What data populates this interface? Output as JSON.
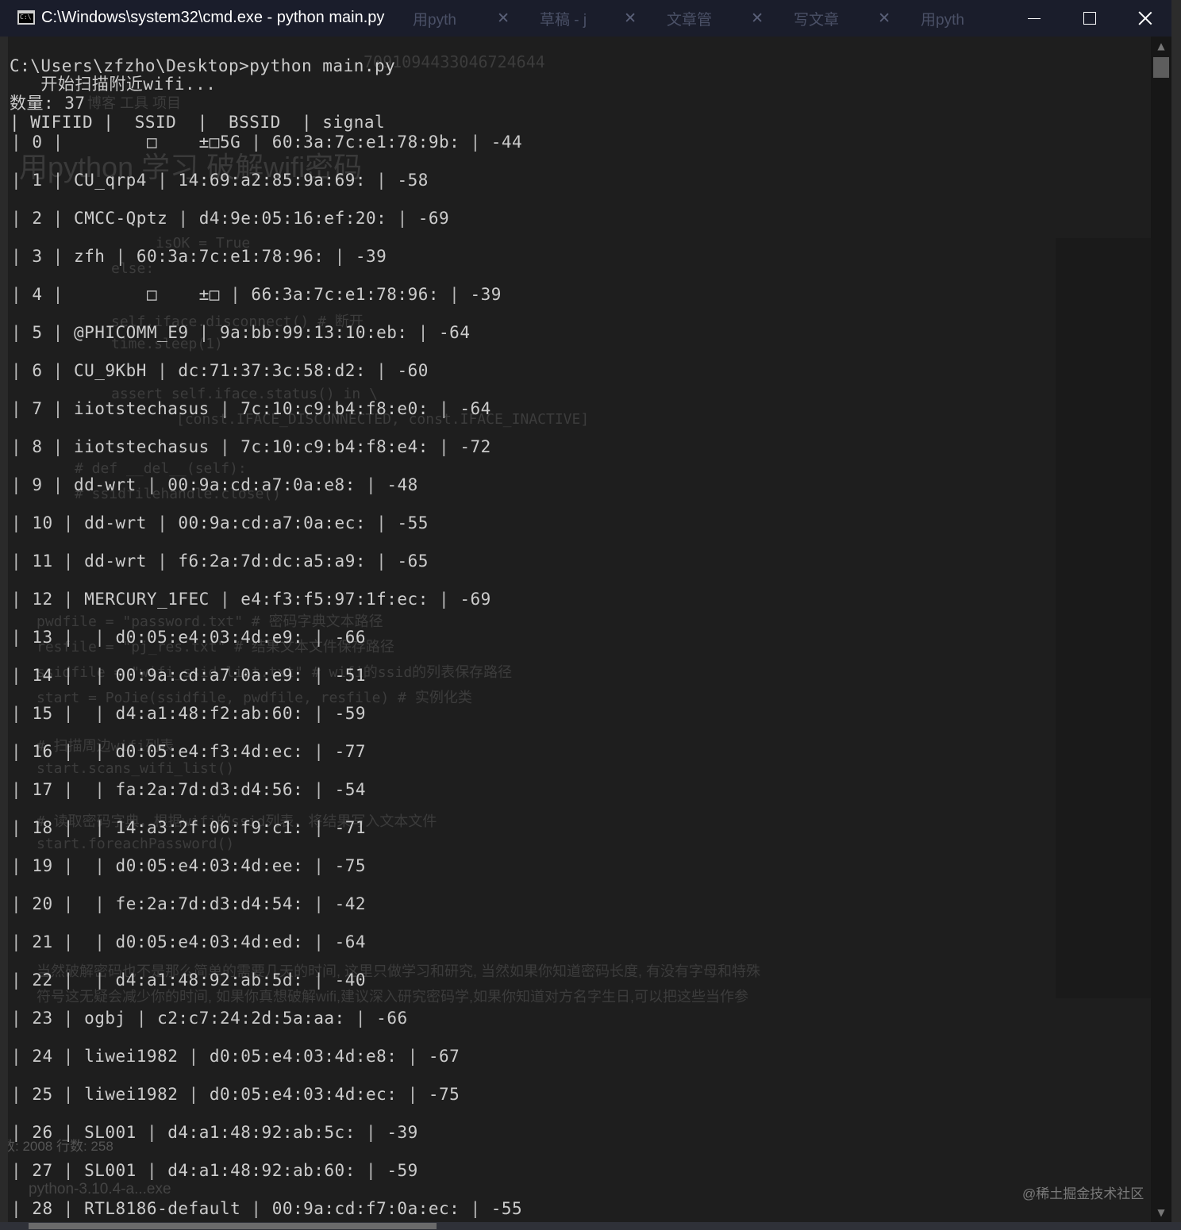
{
  "window": {
    "title": "C:\\Windows\\system32\\cmd.exe - python  main.py",
    "background_tabs": [
      "用pyth",
      "草稿 - j",
      "文章管",
      "写文章",
      "用pyth"
    ]
  },
  "console": {
    "command_line": "C:\\Users\\zfzho\\Desktop>python main.py",
    "scan_message": "   开始扫描附近wifi...",
    "count_line": "数量: 37",
    "header_line": "| WIFIID |  SSID  |  BSSID  | signal",
    "rows": [
      {
        "id": "0",
        "ssid": "       □    ±□5G",
        "bssid": "60:3a:7c:e1:78:9b:",
        "signal": "-44"
      },
      {
        "id": "1",
        "ssid": "CU_qrp4",
        "bssid": "14:69:a2:85:9a:69:",
        "signal": "-58"
      },
      {
        "id": "2",
        "ssid": "CMCC-Qptz",
        "bssid": "d4:9e:05:16:ef:20:",
        "signal": "-69"
      },
      {
        "id": "3",
        "ssid": "zfh",
        "bssid": "60:3a:7c:e1:78:96:",
        "signal": "-39"
      },
      {
        "id": "4",
        "ssid": "       □    ±□",
        "bssid": "66:3a:7c:e1:78:96:",
        "signal": "-39"
      },
      {
        "id": "5",
        "ssid": "@PHICOMM_E9",
        "bssid": "9a:bb:99:13:10:eb:",
        "signal": "-64"
      },
      {
        "id": "6",
        "ssid": "CU_9KbH",
        "bssid": "dc:71:37:3c:58:d2:",
        "signal": "-60"
      },
      {
        "id": "7",
        "ssid": "iiotstechasus",
        "bssid": "7c:10:c9:b4:f8:e0:",
        "signal": "-64"
      },
      {
        "id": "8",
        "ssid": "iiotstechasus",
        "bssid": "7c:10:c9:b4:f8:e4:",
        "signal": "-72"
      },
      {
        "id": "9",
        "ssid": "dd-wrt",
        "bssid": "00:9a:cd:a7:0a:e8:",
        "signal": "-48"
      },
      {
        "id": "10",
        "ssid": "dd-wrt",
        "bssid": "00:9a:cd:a7:0a:ec:",
        "signal": "-55"
      },
      {
        "id": "11",
        "ssid": "dd-wrt",
        "bssid": "f6:2a:7d:dc:a5:a9:",
        "signal": "-65"
      },
      {
        "id": "12",
        "ssid": "MERCURY_1FEC",
        "bssid": "e4:f3:f5:97:1f:ec:",
        "signal": "-69"
      },
      {
        "id": "13",
        "ssid": "",
        "bssid": "d0:05:e4:03:4d:e9:",
        "signal": "-66"
      },
      {
        "id": "14",
        "ssid": "",
        "bssid": "00:9a:cd:a7:0a:e9:",
        "signal": "-51"
      },
      {
        "id": "15",
        "ssid": "",
        "bssid": "d4:a1:48:f2:ab:60:",
        "signal": "-59"
      },
      {
        "id": "16",
        "ssid": "",
        "bssid": "d0:05:e4:f3:4d:ec:",
        "signal": "-77"
      },
      {
        "id": "17",
        "ssid": "",
        "bssid": "fa:2a:7d:d3:d4:56:",
        "signal": "-54"
      },
      {
        "id": "18",
        "ssid": "",
        "bssid": "14:a3:2f:06:f9:c1:",
        "signal": "-71"
      },
      {
        "id": "19",
        "ssid": "",
        "bssid": "d0:05:e4:03:4d:ee:",
        "signal": "-75"
      },
      {
        "id": "20",
        "ssid": "",
        "bssid": "fe:2a:7d:d3:d4:54:",
        "signal": "-42"
      },
      {
        "id": "21",
        "ssid": "",
        "bssid": "d0:05:e4:03:4d:ed:",
        "signal": "-64"
      },
      {
        "id": "22",
        "ssid": "",
        "bssid": "d4:a1:48:92:ab:5d:",
        "signal": "-40"
      },
      {
        "id": "23",
        "ssid": "ogbj",
        "bssid": "c2:c7:24:2d:5a:aa:",
        "signal": "-66"
      },
      {
        "id": "24",
        "ssid": "liwei1982",
        "bssid": "d0:05:e4:03:4d:e8:",
        "signal": "-67"
      },
      {
        "id": "25",
        "ssid": "liwei1982",
        "bssid": "d0:05:e4:03:4d:ec:",
        "signal": "-75"
      },
      {
        "id": "26",
        "ssid": "SL001",
        "bssid": "d4:a1:48:92:ab:5c:",
        "signal": "-39"
      },
      {
        "id": "27",
        "ssid": "SL001",
        "bssid": "d4:a1:48:92:ab:60:",
        "signal": "-59"
      },
      {
        "id": "28",
        "ssid": "RTL8186-default",
        "bssid": "00:9a:cd:f7:0a:ec:",
        "signal": "-55"
      }
    ]
  },
  "background_ghost": {
    "url_fragment": "7091094433046724644",
    "bookmarks": "博客     工具     项目",
    "article_title": "用python 学习 破解wifi密码",
    "code_lines": [
      "isOK = True",
      "else:",
      "self.iface.disconnect()  # 断开",
      "time.sleep(1)",
      "assert self.iface.status() in \\",
      "[const.IFACE_DISCONNECTED, const.IFACE_INACTIVE]",
      "# def __del__(self):",
      "#     ssidfilehandle.close()",
      "pwdfile   = \"password.txt\"  # 密码字典文本路径",
      "resfile   = \"pj_res.txt\"  # 结果文本文件保存路径",
      "ssidfile = \"wifi_ssid_list.txt\"  # wifi的ssid的列表保存路径",
      "start      = PoJie(ssidfile, pwdfile, resfile)  # 实例化类",
      "# 扫描周边wifi列表",
      "start.scans_wifi_list()",
      "# 读取密码字典，根据wifi的ssid列表，将结果写入文本文件",
      "start.foreachPassword()"
    ],
    "article_text": [
      "当然破解密码也不是那么简单的需要几天的时间, 这里只做学习和研究, 当然如果你知道密码长度, 有没有字母和特殊",
      "符号这无疑会减少你的时间, 如果你真想破解wifi,建议深入研究密码学,如果你知道对方名字生日,可以把这些当作参"
    ],
    "status_left": "数: 2008     行数: 258",
    "taskbar_item": "python-3.10.4-a...exe"
  },
  "watermark": "@稀土掘金技术社区",
  "colors": {
    "console_bg": "#1e1e1e",
    "console_text": "#cccccc",
    "titlebar_bg": "#1a1d2b"
  }
}
